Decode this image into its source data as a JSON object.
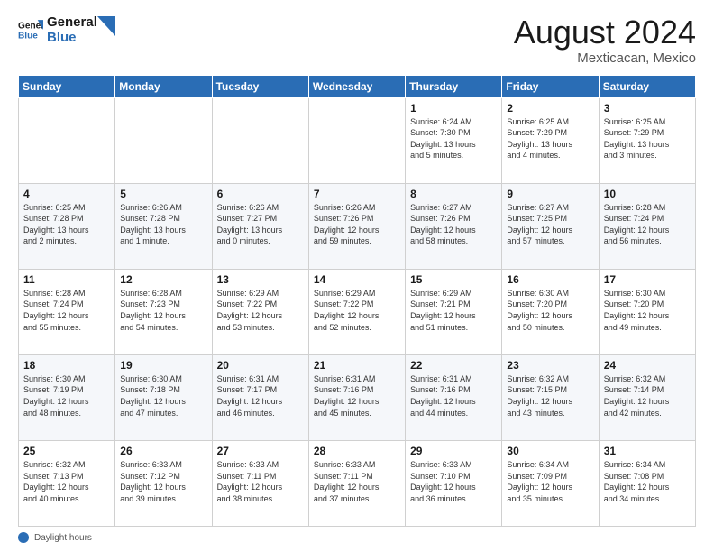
{
  "header": {
    "logo_line1": "General",
    "logo_line2": "Blue",
    "month_year": "August 2024",
    "location": "Mexticacan, Mexico"
  },
  "days_of_week": [
    "Sunday",
    "Monday",
    "Tuesday",
    "Wednesday",
    "Thursday",
    "Friday",
    "Saturday"
  ],
  "weeks": [
    [
      {
        "day": "",
        "info": ""
      },
      {
        "day": "",
        "info": ""
      },
      {
        "day": "",
        "info": ""
      },
      {
        "day": "",
        "info": ""
      },
      {
        "day": "1",
        "info": "Sunrise: 6:24 AM\nSunset: 7:30 PM\nDaylight: 13 hours\nand 5 minutes."
      },
      {
        "day": "2",
        "info": "Sunrise: 6:25 AM\nSunset: 7:29 PM\nDaylight: 13 hours\nand 4 minutes."
      },
      {
        "day": "3",
        "info": "Sunrise: 6:25 AM\nSunset: 7:29 PM\nDaylight: 13 hours\nand 3 minutes."
      }
    ],
    [
      {
        "day": "4",
        "info": "Sunrise: 6:25 AM\nSunset: 7:28 PM\nDaylight: 13 hours\nand 2 minutes."
      },
      {
        "day": "5",
        "info": "Sunrise: 6:26 AM\nSunset: 7:28 PM\nDaylight: 13 hours\nand 1 minute."
      },
      {
        "day": "6",
        "info": "Sunrise: 6:26 AM\nSunset: 7:27 PM\nDaylight: 13 hours\nand 0 minutes."
      },
      {
        "day": "7",
        "info": "Sunrise: 6:26 AM\nSunset: 7:26 PM\nDaylight: 12 hours\nand 59 minutes."
      },
      {
        "day": "8",
        "info": "Sunrise: 6:27 AM\nSunset: 7:26 PM\nDaylight: 12 hours\nand 58 minutes."
      },
      {
        "day": "9",
        "info": "Sunrise: 6:27 AM\nSunset: 7:25 PM\nDaylight: 12 hours\nand 57 minutes."
      },
      {
        "day": "10",
        "info": "Sunrise: 6:28 AM\nSunset: 7:24 PM\nDaylight: 12 hours\nand 56 minutes."
      }
    ],
    [
      {
        "day": "11",
        "info": "Sunrise: 6:28 AM\nSunset: 7:24 PM\nDaylight: 12 hours\nand 55 minutes."
      },
      {
        "day": "12",
        "info": "Sunrise: 6:28 AM\nSunset: 7:23 PM\nDaylight: 12 hours\nand 54 minutes."
      },
      {
        "day": "13",
        "info": "Sunrise: 6:29 AM\nSunset: 7:22 PM\nDaylight: 12 hours\nand 53 minutes."
      },
      {
        "day": "14",
        "info": "Sunrise: 6:29 AM\nSunset: 7:22 PM\nDaylight: 12 hours\nand 52 minutes."
      },
      {
        "day": "15",
        "info": "Sunrise: 6:29 AM\nSunset: 7:21 PM\nDaylight: 12 hours\nand 51 minutes."
      },
      {
        "day": "16",
        "info": "Sunrise: 6:30 AM\nSunset: 7:20 PM\nDaylight: 12 hours\nand 50 minutes."
      },
      {
        "day": "17",
        "info": "Sunrise: 6:30 AM\nSunset: 7:20 PM\nDaylight: 12 hours\nand 49 minutes."
      }
    ],
    [
      {
        "day": "18",
        "info": "Sunrise: 6:30 AM\nSunset: 7:19 PM\nDaylight: 12 hours\nand 48 minutes."
      },
      {
        "day": "19",
        "info": "Sunrise: 6:30 AM\nSunset: 7:18 PM\nDaylight: 12 hours\nand 47 minutes."
      },
      {
        "day": "20",
        "info": "Sunrise: 6:31 AM\nSunset: 7:17 PM\nDaylight: 12 hours\nand 46 minutes."
      },
      {
        "day": "21",
        "info": "Sunrise: 6:31 AM\nSunset: 7:16 PM\nDaylight: 12 hours\nand 45 minutes."
      },
      {
        "day": "22",
        "info": "Sunrise: 6:31 AM\nSunset: 7:16 PM\nDaylight: 12 hours\nand 44 minutes."
      },
      {
        "day": "23",
        "info": "Sunrise: 6:32 AM\nSunset: 7:15 PM\nDaylight: 12 hours\nand 43 minutes."
      },
      {
        "day": "24",
        "info": "Sunrise: 6:32 AM\nSunset: 7:14 PM\nDaylight: 12 hours\nand 42 minutes."
      }
    ],
    [
      {
        "day": "25",
        "info": "Sunrise: 6:32 AM\nSunset: 7:13 PM\nDaylight: 12 hours\nand 40 minutes."
      },
      {
        "day": "26",
        "info": "Sunrise: 6:33 AM\nSunset: 7:12 PM\nDaylight: 12 hours\nand 39 minutes."
      },
      {
        "day": "27",
        "info": "Sunrise: 6:33 AM\nSunset: 7:11 PM\nDaylight: 12 hours\nand 38 minutes."
      },
      {
        "day": "28",
        "info": "Sunrise: 6:33 AM\nSunset: 7:11 PM\nDaylight: 12 hours\nand 37 minutes."
      },
      {
        "day": "29",
        "info": "Sunrise: 6:33 AM\nSunset: 7:10 PM\nDaylight: 12 hours\nand 36 minutes."
      },
      {
        "day": "30",
        "info": "Sunrise: 6:34 AM\nSunset: 7:09 PM\nDaylight: 12 hours\nand 35 minutes."
      },
      {
        "day": "31",
        "info": "Sunrise: 6:34 AM\nSunset: 7:08 PM\nDaylight: 12 hours\nand 34 minutes."
      }
    ]
  ],
  "footer": {
    "label": "Daylight hours"
  },
  "colors": {
    "header_bg": "#2a6db5",
    "accent": "#2a6db5"
  }
}
